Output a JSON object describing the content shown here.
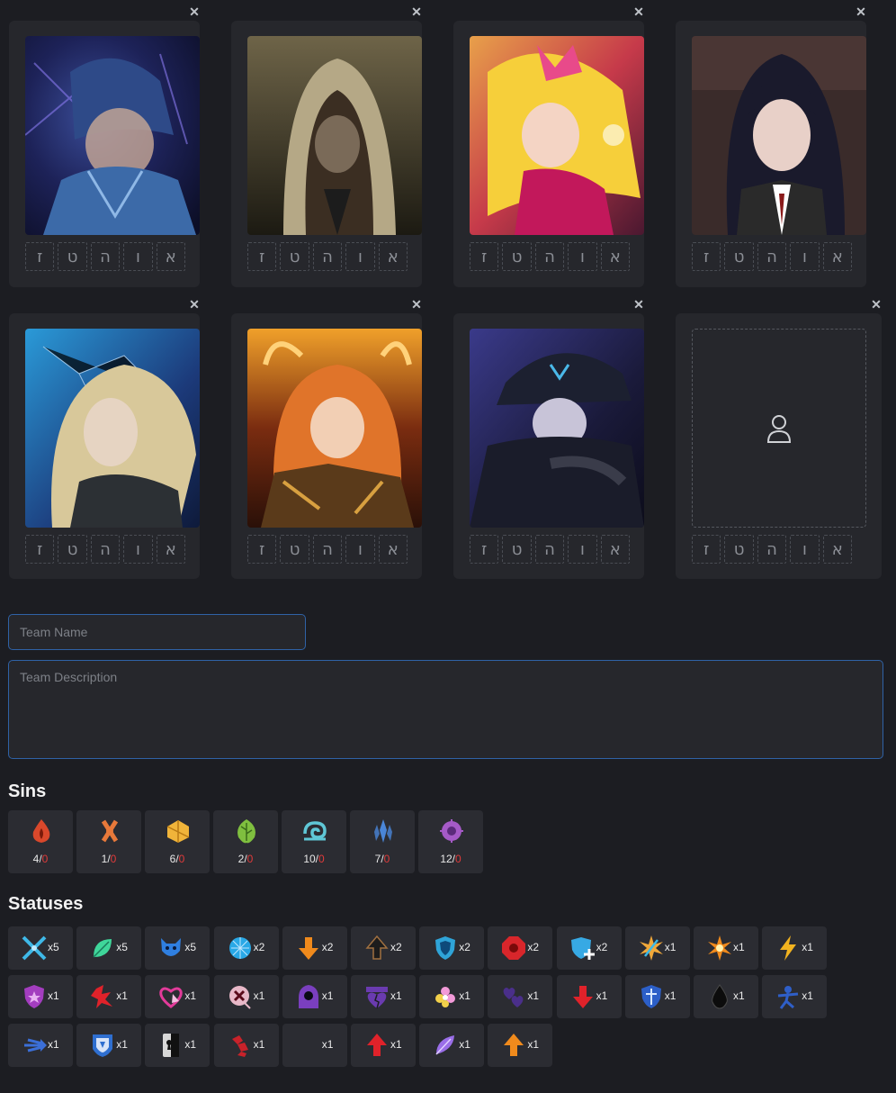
{
  "slots": [
    {
      "filled": true,
      "letters": [
        "ז",
        "ט",
        "ה",
        "ו",
        "א"
      ]
    },
    {
      "filled": true,
      "letters": [
        "ז",
        "ט",
        "ה",
        "ו",
        "א"
      ]
    },
    {
      "filled": true,
      "letters": [
        "ז",
        "ט",
        "ה",
        "ו",
        "א"
      ]
    },
    {
      "filled": true,
      "letters": [
        "ז",
        "ט",
        "ה",
        "ו",
        "א"
      ]
    },
    {
      "filled": true,
      "letters": [
        "ז",
        "ט",
        "ה",
        "ו",
        "א"
      ]
    },
    {
      "filled": true,
      "letters": [
        "ז",
        "ט",
        "ה",
        "ו",
        "א"
      ]
    },
    {
      "filled": true,
      "letters": [
        "ז",
        "ט",
        "ה",
        "ו",
        "א"
      ]
    },
    {
      "filled": false,
      "letters": [
        "ז",
        "ט",
        "ה",
        "ו",
        "א"
      ]
    }
  ],
  "remove_glyph": "✕",
  "form": {
    "team_name_placeholder": "Team Name",
    "team_description_placeholder": "Team Description"
  },
  "sins": {
    "title": "Sins",
    "items": [
      {
        "icon": "wrath-icon",
        "count": "4/",
        "required": "0",
        "color": "#d9482b"
      },
      {
        "icon": "lust-icon",
        "count": "1/",
        "required": "0",
        "color": "#e8793a"
      },
      {
        "icon": "sloth-icon",
        "count": "6/",
        "required": "0",
        "color": "#f0b43a"
      },
      {
        "icon": "gluttony-icon",
        "count": "2/",
        "required": "0",
        "color": "#7fbf3f"
      },
      {
        "icon": "gloom-icon",
        "count": "10/",
        "required": "0",
        "color": "#5fc7d6"
      },
      {
        "icon": "pride-icon",
        "count": "7/",
        "required": "0",
        "color": "#4a86d8"
      },
      {
        "icon": "envy-icon",
        "count": "12/",
        "required": "0",
        "color": "#a55ac7"
      }
    ]
  },
  "statuses": {
    "title": "Statuses",
    "items": [
      {
        "icon": "crossed-blades-icon",
        "count": "x5",
        "color": "#3fb9e8"
      },
      {
        "icon": "green-leaf-icon",
        "count": "x5",
        "color": "#3fd69a"
      },
      {
        "icon": "blue-beast-icon",
        "count": "x5",
        "color": "#2f7fe0"
      },
      {
        "icon": "blue-orb-icon",
        "count": "x2",
        "color": "#29a8e6"
      },
      {
        "icon": "orange-down-arrow-icon",
        "count": "x2",
        "color": "#f08a1c"
      },
      {
        "icon": "black-up-arrow-icon",
        "count": "x2",
        "color": "#1c1c1c"
      },
      {
        "icon": "shield-icon",
        "count": "x2",
        "color": "#2fa4d8"
      },
      {
        "icon": "red-octagon-icon",
        "count": "x2",
        "color": "#d8262b"
      },
      {
        "icon": "blue-shield-plus-icon",
        "count": "x2",
        "color": "#37a9e4"
      },
      {
        "icon": "burst-sword-icon",
        "count": "x1",
        "color": "#f0a83a"
      },
      {
        "icon": "orange-starburst-icon",
        "count": "x1",
        "color": "#f08a1c"
      },
      {
        "icon": "lightning-icon",
        "count": "x1",
        "color": "#f2b31f"
      },
      {
        "icon": "purple-shield-icon",
        "count": "x1",
        "color": "#a33dbf"
      },
      {
        "icon": "red-shatter-icon",
        "count": "x1",
        "color": "#e0222a"
      },
      {
        "icon": "pink-heart-icon",
        "count": "x1",
        "color": "#e23b9a"
      },
      {
        "icon": "bleed-target-icon",
        "count": "x1",
        "color": "#e8b8c8"
      },
      {
        "icon": "hooded-figure-icon",
        "count": "x1",
        "color": "#7a3fbf"
      },
      {
        "icon": "purple-broken-heart-icon",
        "count": "x1",
        "color": "#6a3bb0"
      },
      {
        "icon": "flower-sparkle-icon",
        "count": "x1",
        "color": "#f29ad8"
      },
      {
        "icon": "dark-hearts-icon",
        "count": "x1",
        "color": "#4a2f8a"
      },
      {
        "icon": "red-down-arrow-icon",
        "count": "x1",
        "color": "#e0222a"
      },
      {
        "icon": "blue-crest-icon",
        "count": "x1",
        "color": "#2c5fc8"
      },
      {
        "icon": "black-drop-icon",
        "count": "x1",
        "color": "#0c0c0c"
      },
      {
        "icon": "blue-figure-icon",
        "count": "x1",
        "color": "#2f5fc8"
      },
      {
        "icon": "blue-speed-icon",
        "count": "x1",
        "color": "#3b6fd8"
      },
      {
        "icon": "blue-badge-icon",
        "count": "x1",
        "color": "#2f6fd0"
      },
      {
        "icon": "keyhole-shield-icon",
        "count": "x1",
        "color": "#d8d8d8"
      },
      {
        "icon": "red-chain-icon",
        "count": "x1",
        "color": "#c8222a"
      },
      {
        "icon": "blank-status-icon",
        "count": "x1",
        "color": "#2b2c32"
      },
      {
        "icon": "red-up-arrow-icon",
        "count": "x1",
        "color": "#e0222a"
      },
      {
        "icon": "violet-feather-icon",
        "count": "x1",
        "color": "#9a6ee8"
      },
      {
        "icon": "orange-up-arrow-icon",
        "count": "x1",
        "color": "#f08a1c"
      }
    ]
  }
}
